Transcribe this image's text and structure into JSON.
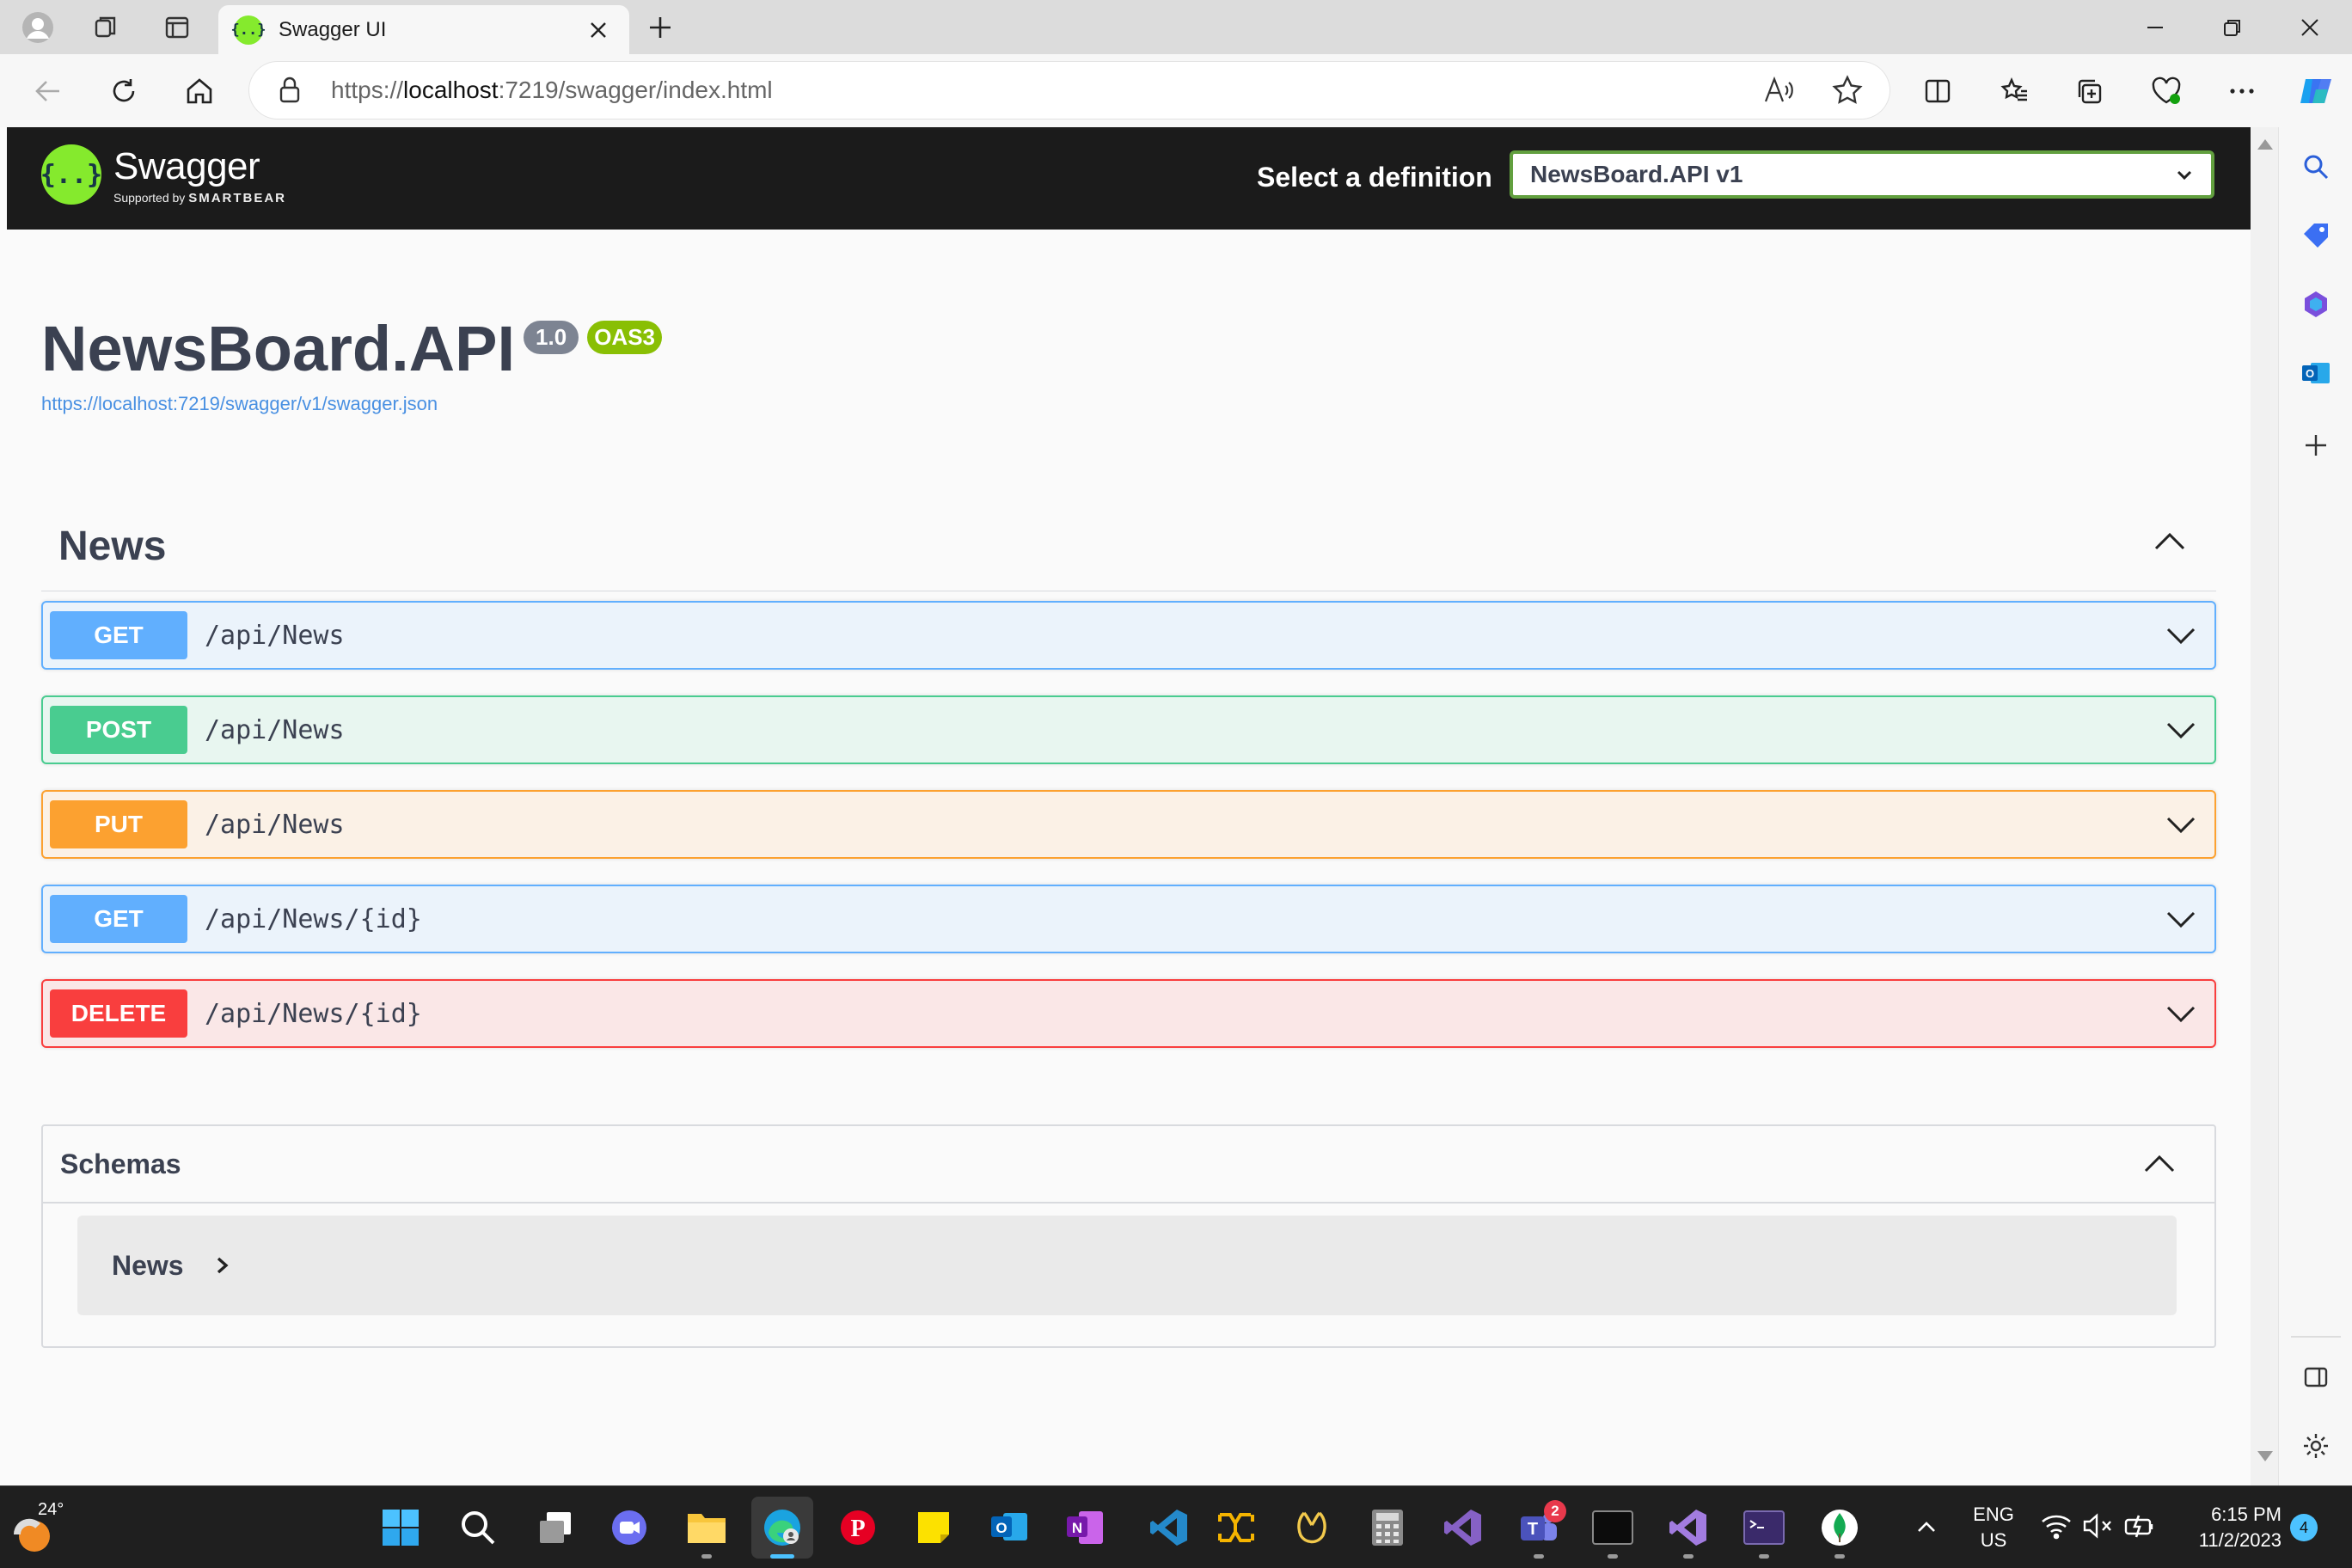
{
  "browser": {
    "tab_title": "Swagger UI",
    "url_scheme": "https://",
    "url_host": "localhost",
    "url_rest": ":7219/swagger/index.html"
  },
  "swagger": {
    "logo_name": "Swagger",
    "logo_supported": "Supported by",
    "logo_brand": "SMARTBEAR",
    "definition_label": "Select a definition",
    "definition_selected": "NewsBoard.API v1",
    "api_title": "NewsBoard.API",
    "version": "1.0",
    "oas": "OAS3",
    "spec_url": "https://localhost:7219/swagger/v1/swagger.json",
    "tag": "News",
    "operations": [
      {
        "method": "GET",
        "path": "/api/News",
        "color": "#61affe",
        "bg": "#ebf3fb"
      },
      {
        "method": "POST",
        "path": "/api/News",
        "color": "#49cc90",
        "bg": "#e8f6f0"
      },
      {
        "method": "PUT",
        "path": "/api/News",
        "color": "#fca130",
        "bg": "#fbf1e6"
      },
      {
        "method": "GET",
        "path": "/api/News/{id}",
        "color": "#61affe",
        "bg": "#ebf3fb"
      },
      {
        "method": "DELETE",
        "path": "/api/News/{id}",
        "color": "#f93e3e",
        "bg": "#fae7e7"
      }
    ],
    "schemas_title": "Schemas",
    "schemas": [
      "News"
    ]
  },
  "taskbar": {
    "temperature": "24°",
    "language": "ENG",
    "region": "US",
    "time": "6:15 PM",
    "date": "11/2/2023",
    "teams_badge": "2",
    "notifications": "4",
    "apps": [
      "start-icon",
      "search-icon",
      "task-view-icon",
      "chat-icon",
      "file-explorer-icon",
      "edge-icon",
      "pinterest-icon",
      "sticky-notes-icon",
      "outlook-icon",
      "onenote-icon",
      "vscode-icon",
      "network-icon",
      "app-icon",
      "calculator-icon",
      "visual-studio-icon",
      "teams-icon",
      "terminal-icon",
      "visual-studio-preview-icon",
      "powershell-icon",
      "mongodb-icon"
    ]
  },
  "colors": {
    "swagger_green": "#85ea2d",
    "topbar": "#1b1b1b",
    "text": "#3b4151",
    "link": "#4990e2"
  }
}
